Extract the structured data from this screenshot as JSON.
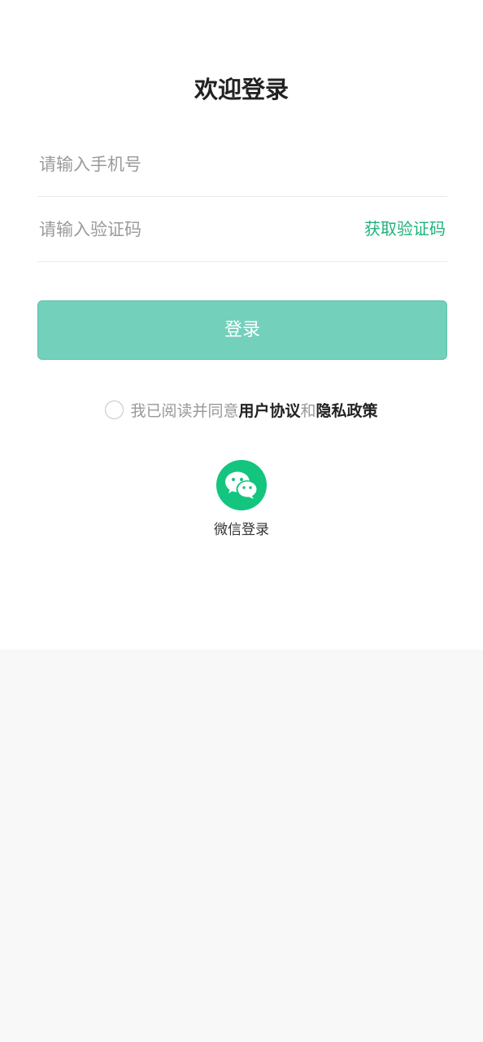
{
  "title": "欢迎登录",
  "phone": {
    "placeholder": "请输入手机号",
    "value": ""
  },
  "code": {
    "placeholder": "请输入验证码",
    "value": "",
    "get_code_label": "获取验证码"
  },
  "login_label": "登录",
  "agreement": {
    "prefix": "我已阅读并同意",
    "user_agreement": "用户协议",
    "and": "和",
    "privacy_policy": "隐私政策",
    "checked": false
  },
  "wechat_login": {
    "icon": "wechat-icon",
    "label": "微信登录"
  },
  "colors": {
    "accent": "#1fb37a",
    "button": "#73d1bb",
    "wechat": "#13c57f",
    "background": "#f8f8f8"
  }
}
